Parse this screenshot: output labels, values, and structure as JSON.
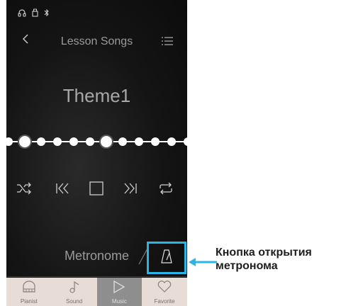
{
  "status_bar": {
    "icons": [
      "headphones-icon",
      "usb-icon",
      "bluetooth-icon"
    ]
  },
  "header": {
    "title": "Lesson Songs",
    "back_icon": "back-icon",
    "menu_icon": "list-menu-icon"
  },
  "song": {
    "title": "Theme1"
  },
  "progress": {
    "dots": 12,
    "current_index": 0,
    "highlighted_index": 5
  },
  "controls": [
    "shuffle-icon",
    "rewind-icon",
    "stop-icon",
    "forward-icon",
    "repeat-icon"
  ],
  "metronome": {
    "label": "Metronome"
  },
  "tabs": [
    {
      "label": "Pianist",
      "icon": "piano-icon",
      "active": false
    },
    {
      "label": "Sound",
      "icon": "music-note-icon",
      "active": false
    },
    {
      "label": "Music",
      "icon": "play-icon",
      "active": true
    },
    {
      "label": "Favorite",
      "icon": "heart-icon",
      "active": false
    }
  ],
  "annotation": {
    "line1": "Кнопка открытия",
    "line2": "метронома"
  },
  "colors": {
    "highlight": "#29b6e6",
    "tab_bg": "#e8dcd6",
    "tab_active": "#8e8e8e"
  }
}
